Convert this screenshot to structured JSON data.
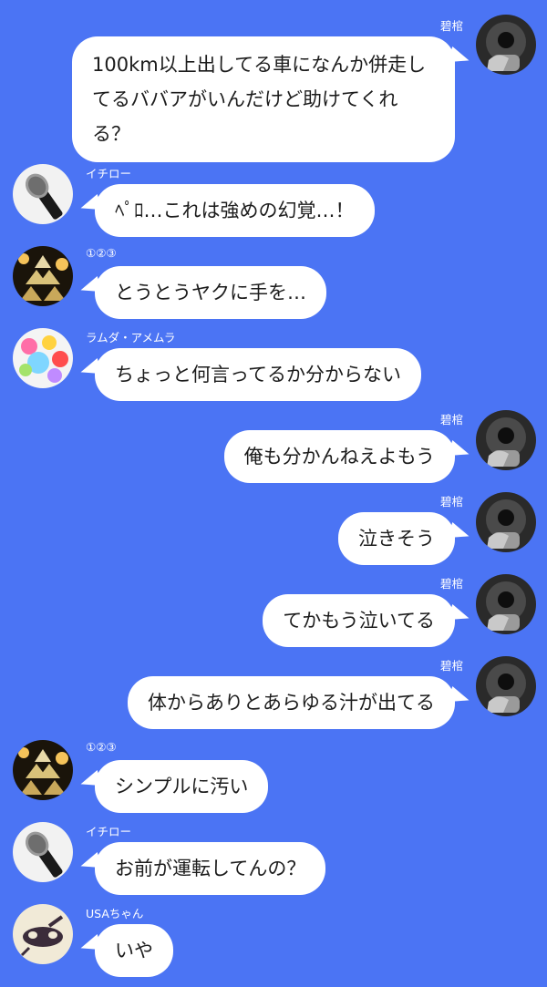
{
  "colors": {
    "background": "#4b74f4",
    "bubble": "#ffffff",
    "text": "#1c1c1c",
    "name": "#ffffff"
  },
  "messages": [
    {
      "side": "right",
      "name": "碧棺",
      "text": "100km以上出してる車になんか併走してるババアがいんだけど助けてくれる？",
      "avatar": "pistol-avatar-icon"
    },
    {
      "side": "left",
      "name": "イチロー",
      "text": "ﾍﾟﾛ…これは強めの幻覚…！",
      "avatar": "microphone-avatar-icon"
    },
    {
      "side": "left",
      "name": "①②③",
      "text": "とうとうヤクに手を…",
      "avatar": "champagne-tower-avatar-icon"
    },
    {
      "side": "left",
      "name": "ラムダ・アメムラ",
      "text": "ちょっと何言ってるか分からない",
      "avatar": "candy-avatar-icon"
    },
    {
      "side": "right",
      "name": "碧棺",
      "text": "俺も分かんねえよもう",
      "avatar": "pistol-avatar-icon"
    },
    {
      "side": "right",
      "name": "碧棺",
      "text": "泣きそう",
      "avatar": "pistol-avatar-icon"
    },
    {
      "side": "right",
      "name": "碧棺",
      "text": "てかもう泣いてる",
      "avatar": "pistol-avatar-icon"
    },
    {
      "side": "right",
      "name": "碧棺",
      "text": "体からありとあらゆる汁が出てる",
      "avatar": "pistol-avatar-icon"
    },
    {
      "side": "left",
      "name": "①②③",
      "text": "シンプルに汚い",
      "avatar": "champagne-tower-avatar-icon"
    },
    {
      "side": "left",
      "name": "イチロー",
      "text": "お前が運転してんの？",
      "avatar": "microphone-avatar-icon"
    },
    {
      "side": "left",
      "name": "USAちゃん",
      "text": "いや",
      "avatar": "rabbit-avatar-icon"
    }
  ]
}
